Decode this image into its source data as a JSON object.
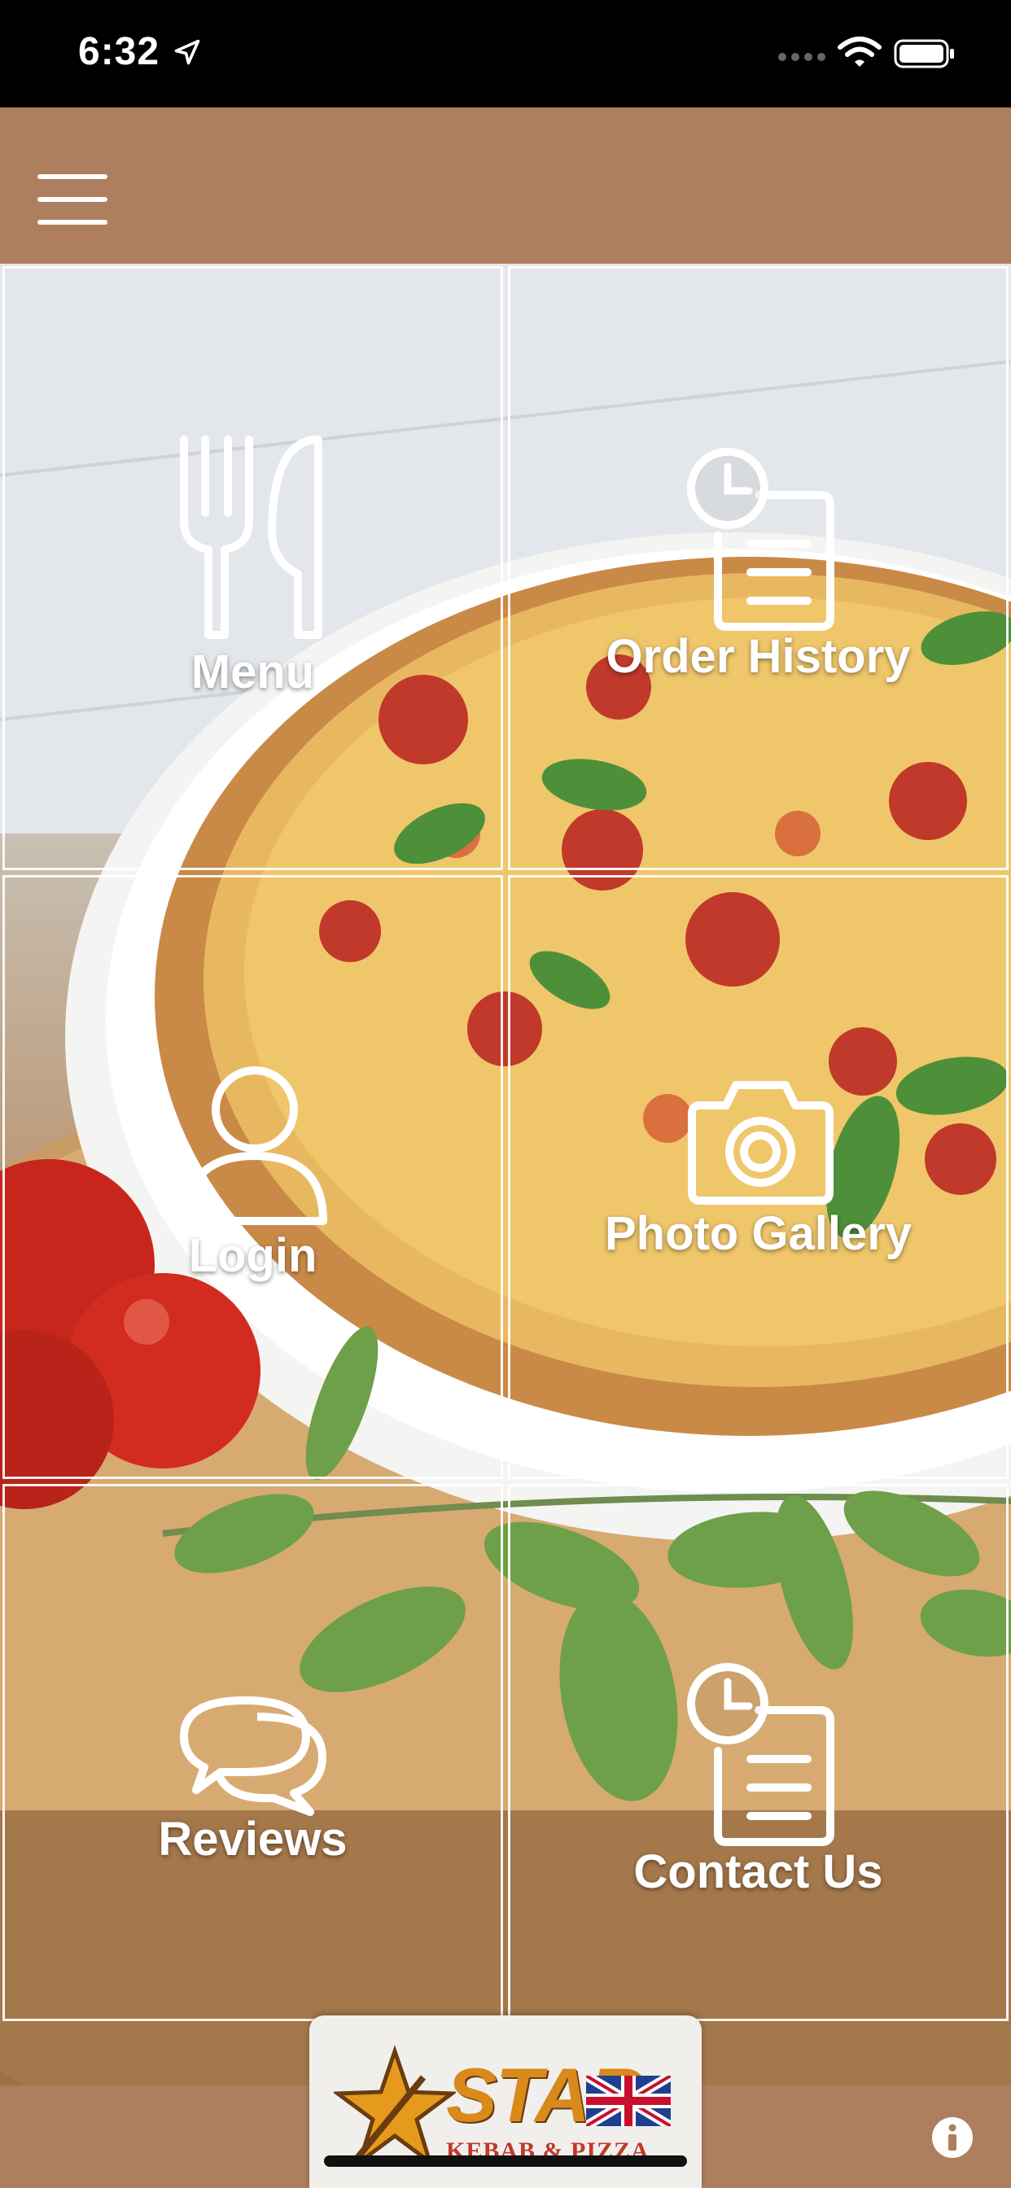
{
  "status_bar": {
    "time": "6:32"
  },
  "header": {
    "menu_icon": "hamburger-icon"
  },
  "tiles": [
    {
      "label": "Menu",
      "icon": "fork-knife-icon"
    },
    {
      "label": "Order History",
      "icon": "clock-document-icon"
    },
    {
      "label": "Login",
      "icon": "user-icon"
    },
    {
      "label": "Photo Gallery",
      "icon": "camera-icon"
    },
    {
      "label": "Reviews",
      "icon": "chat-bubbles-icon"
    },
    {
      "label": "Contact Us",
      "icon": "clock-document-icon"
    }
  ],
  "logo": {
    "name": "STAR",
    "tagline": "KEBAB & PIZZA"
  },
  "footer": {
    "info_icon": "info-icon"
  },
  "colors": {
    "header_brown": "#ae7f5e",
    "status_bar": "#000000",
    "tile_border": "#ffffff",
    "logo_orange": "#d98a1a",
    "logo_red": "#c0392b"
  }
}
